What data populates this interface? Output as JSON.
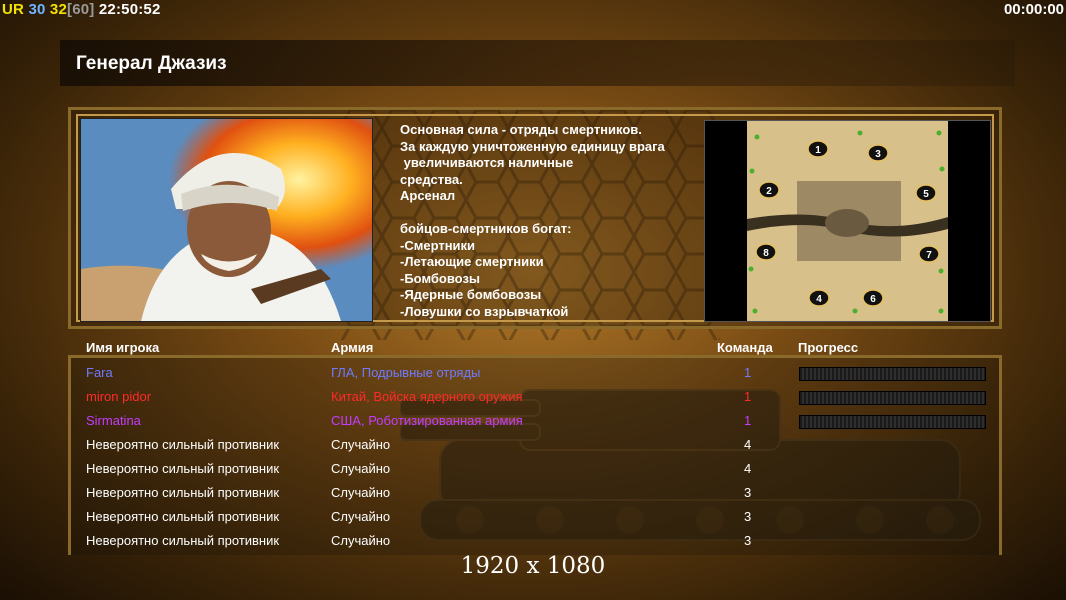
{
  "hud": {
    "mode": "UR",
    "latency": "30",
    "fps": "32",
    "fps_max": "[60]",
    "clock": "22:50:52",
    "timer": "00:00:00"
  },
  "general": {
    "title": "Генерал Джазиз",
    "description": "Основная сила - отряды смертников.\nЗа каждую уничтоженную единицу врага\n увеличиваются наличные\nсредства.\nАрсенал\n\nбойцов-смертников богат:\n-Смертники\n-Летающие смертники\n-Бомбовозы\n-Ядерные бомбовозы\n-Ловушки со взрывчаткой"
  },
  "map": {
    "start_positions": [
      "1",
      "3",
      "2",
      "5",
      "8",
      "7",
      "4",
      "6"
    ]
  },
  "table": {
    "headers": {
      "name": "Имя игрока",
      "army": "Армия",
      "team": "Команда",
      "progress": "Прогресс"
    },
    "rows": [
      {
        "name": "Fara",
        "army": "ГЛА, Подрывные отряды",
        "team": "1",
        "color": "#6f7bff",
        "progress": 0
      },
      {
        "name": "miron pidor",
        "army": "Китай, Войска ядерного оружия",
        "team": "1",
        "color": "#ff2a2a",
        "progress": 0
      },
      {
        "name": "Sirmatina",
        "army": "США, Роботизированная армия",
        "team": "1",
        "color": "#c43cff",
        "progress": 0
      },
      {
        "name": "Невероятно сильный противник",
        "army": "Случайно",
        "team": "4",
        "color": "#ffffff"
      },
      {
        "name": "Невероятно сильный противник",
        "army": "Случайно",
        "team": "4",
        "color": "#ffffff"
      },
      {
        "name": "Невероятно сильный противник",
        "army": "Случайно",
        "team": "3",
        "color": "#ffffff"
      },
      {
        "name": "Невероятно сильный противник",
        "army": "Случайно",
        "team": "3",
        "color": "#ffffff"
      },
      {
        "name": "Невероятно сильный противник",
        "army": "Случайно",
        "team": "3",
        "color": "#ffffff"
      }
    ]
  },
  "resolution": "1920 x 1080"
}
